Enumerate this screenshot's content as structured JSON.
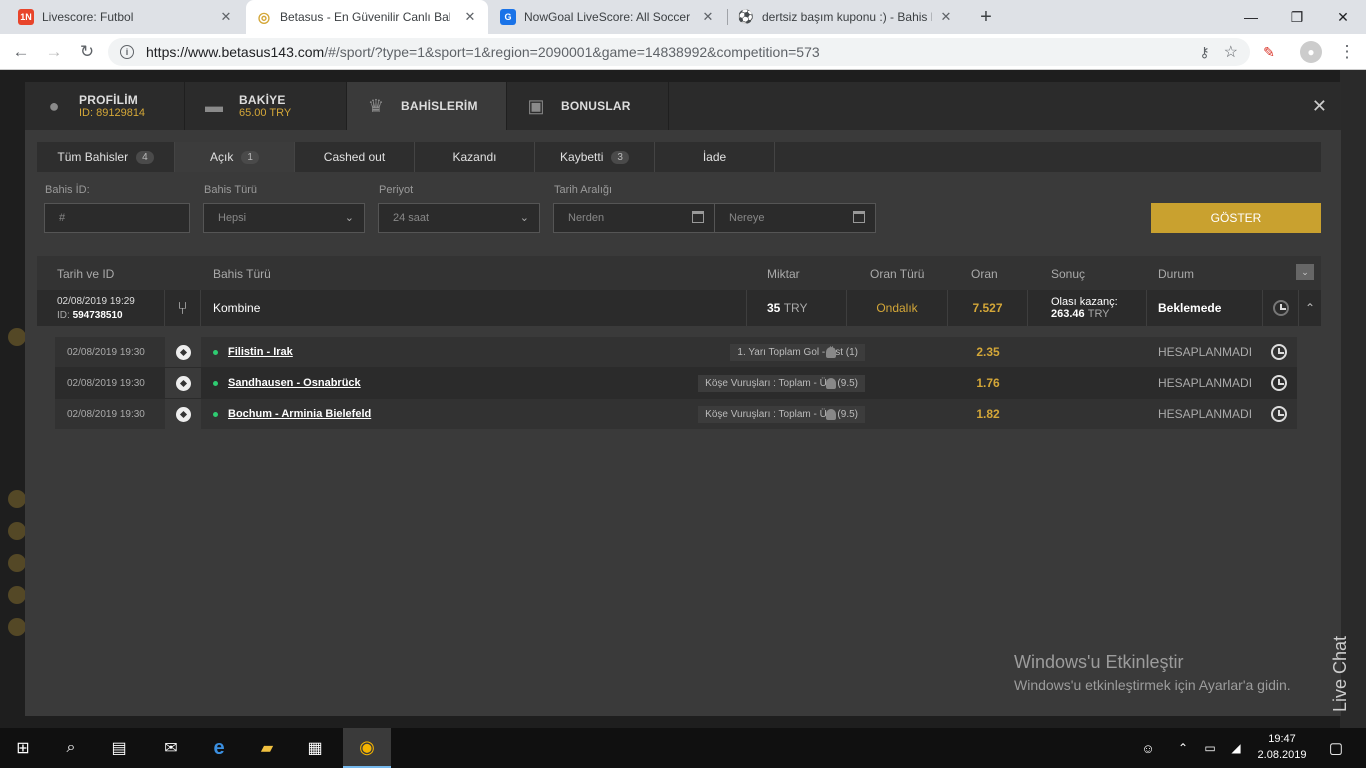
{
  "browser": {
    "tabs": [
      {
        "title": "Livescore: Futbol",
        "favicon": "1N",
        "fav_color": "#e8442a"
      },
      {
        "title": "Betasus - En Güvenilir Canlı Bahis",
        "favicon": "◎",
        "fav_color": "#d4a738"
      },
      {
        "title": "NowGoal LiveScore: All Soccer Sc",
        "favicon": "G",
        "fav_color": "#1a73e8"
      },
      {
        "title": "dertsiz başım kuponu :) - Bahis L",
        "favicon": "⚽",
        "fav_color": "#444"
      }
    ],
    "url_host": "https://www.betasus143.com",
    "url_rest": "/#/sport/?type=1&sport=1&region=2090001&game=14838992&competition=573"
  },
  "account_tabs": [
    {
      "label": "PROFİLİM",
      "sub": "ID: 89129814",
      "icon": "person-icon"
    },
    {
      "label": "BAKİYE",
      "sub": "65.00 TRY",
      "icon": "wallet-icon"
    },
    {
      "label": "BAHİSLERİM",
      "sub": "",
      "icon": "trophy-icon"
    },
    {
      "label": "BONUSLAR",
      "sub": "",
      "icon": "gift-icon"
    }
  ],
  "filter_tabs": [
    {
      "label": "Tüm Bahisler",
      "count": "4"
    },
    {
      "label": "Açık",
      "count": "1"
    },
    {
      "label": "Cashed out",
      "count": ""
    },
    {
      "label": "Kazandı",
      "count": ""
    },
    {
      "label": "Kaybetti",
      "count": "3"
    },
    {
      "label": "İade",
      "count": ""
    }
  ],
  "filters": {
    "bet_id_label": "Bahis İD:",
    "bet_id_placeholder": "#",
    "bet_type_label": "Bahis Türü",
    "bet_type_value": "Hepsi",
    "period_label": "Periyot",
    "period_value": "24 saat",
    "date_range_label": "Tarih Aralığı",
    "from_placeholder": "Nerden",
    "to_placeholder": "Nereye",
    "show_button": "GÖSTER"
  },
  "table_headers": {
    "date_id": "Tarih ve ID",
    "bet_type": "Bahis Türü",
    "amount": "Miktar",
    "odds_type": "Oran Türü",
    "odds": "Oran",
    "result": "Sonuç",
    "status": "Durum"
  },
  "bet": {
    "date": "02/08/2019 19:29",
    "id_label": "ID:",
    "id": "594738510",
    "type": "Kombine",
    "amount": "35",
    "currency": "TRY",
    "odds_type": "Ondalık",
    "odds": "7.527",
    "possible_win_label": "Olası kazanç:",
    "possible_win": "263.46",
    "possible_win_currency": "TRY",
    "status": "Beklemede"
  },
  "selections": [
    {
      "date": "02/08/2019 19:30",
      "match": "Filistin - Irak",
      "market": "1. Yarı Toplam Gol - Üst (1)",
      "odds": "2.35",
      "status": "HESAPLANMADI"
    },
    {
      "date": "02/08/2019 19:30",
      "match": "Sandhausen - Osnabrück",
      "market": "Köşe Vuruşları : Toplam - Üst (9.5)",
      "odds": "1.76",
      "status": "HESAPLANMADI"
    },
    {
      "date": "02/08/2019 19:30",
      "match": "Bochum - Arminia Bielefeld",
      "market": "Köşe Vuruşları : Toplam - Üst (9.5)",
      "odds": "1.82",
      "status": "HESAPLANMADI"
    }
  ],
  "watermark": {
    "title": "Windows'u Etkinleştir",
    "subtitle": "Windows'u etkinleştirmek için Ayarlar'a gidin."
  },
  "live_chat": "Live Chat",
  "taskbar": {
    "time": "19:47",
    "date": "2.08.2019"
  },
  "colors": {
    "accent": "#c9a12f",
    "odds": "#d4a738",
    "status_dot": "#2ecc71"
  }
}
